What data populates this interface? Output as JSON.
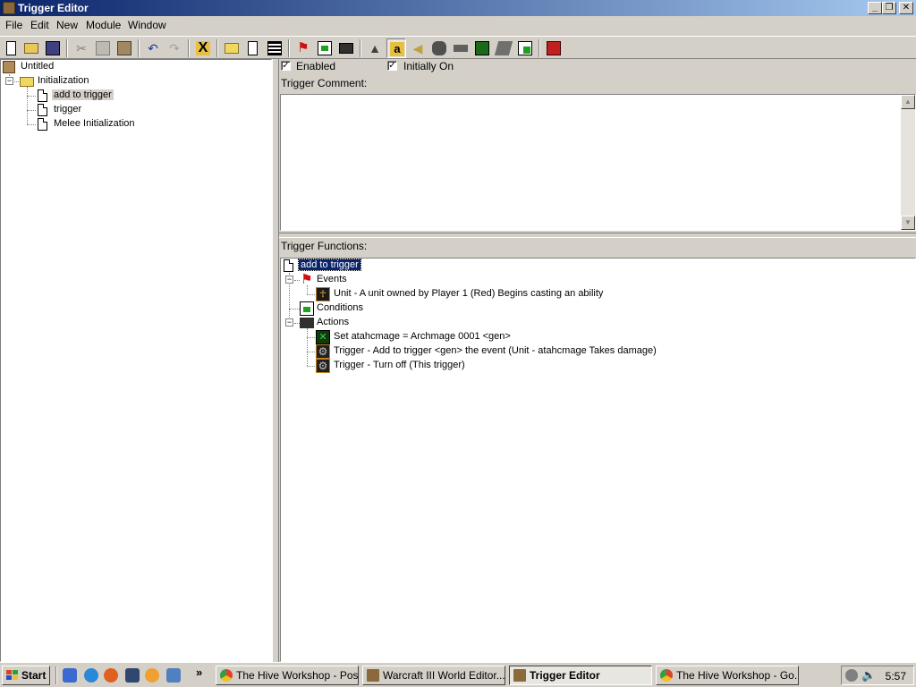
{
  "window": {
    "title": "Trigger Editor"
  },
  "caption_buttons": {
    "minimize": "_",
    "restore": "❐",
    "close": "✕"
  },
  "menu": [
    "File",
    "Edit",
    "New",
    "Module",
    "Window"
  ],
  "toolbar": {
    "icons": [
      "new-icon",
      "open-icon",
      "save-icon",
      "cut-icon",
      "copy-icon",
      "paste-icon",
      "undo-icon",
      "redo-icon",
      "delete-icon",
      "new-category-icon",
      "new-trigger-icon",
      "new-comment-icon",
      "new-event-icon",
      "new-condition-icon",
      "new-action-icon",
      "terrain-editor-icon",
      "trigger-editor-icon",
      "sound-editor-icon",
      "object-editor-icon",
      "campaign-editor-icon",
      "ai-editor-icon",
      "object-manager-icon",
      "import-manager-icon",
      "test-map-icon"
    ]
  },
  "tree": {
    "root": "Untitled",
    "category": "Initialization",
    "triggers": [
      "add to trigger",
      "trigger",
      "Melee Initialization"
    ]
  },
  "trigger": {
    "enabled_label": "Enabled",
    "enabled_checked": true,
    "initially_on_label": "Initially On",
    "initially_on_checked": true,
    "comment_label": "Trigger Comment:",
    "comment": "",
    "functions_label": "Trigger Functions:"
  },
  "functions": {
    "name": "add to trigger",
    "events_label": "Events",
    "events": [
      "Unit - A unit owned by Player 1 (Red) Begins casting an ability"
    ],
    "conditions_label": "Conditions",
    "actions_label": "Actions",
    "actions": [
      "Set atahcmage = Archmage 0001 <gen>",
      "Trigger - Add to trigger <gen> the event (Unit - atahcmage Takes damage)",
      "Trigger - Turn off (This trigger)"
    ]
  },
  "taskbar": {
    "start": "Start",
    "chevron": "»",
    "tasks": [
      {
        "label": "The Hive Workshop - Pos...",
        "active": false
      },
      {
        "label": "Warcraft III World Editor...",
        "active": false
      },
      {
        "label": "Trigger Editor",
        "active": true
      },
      {
        "label": "The Hive Workshop - Go...",
        "active": false
      }
    ],
    "clock": "5:57"
  }
}
